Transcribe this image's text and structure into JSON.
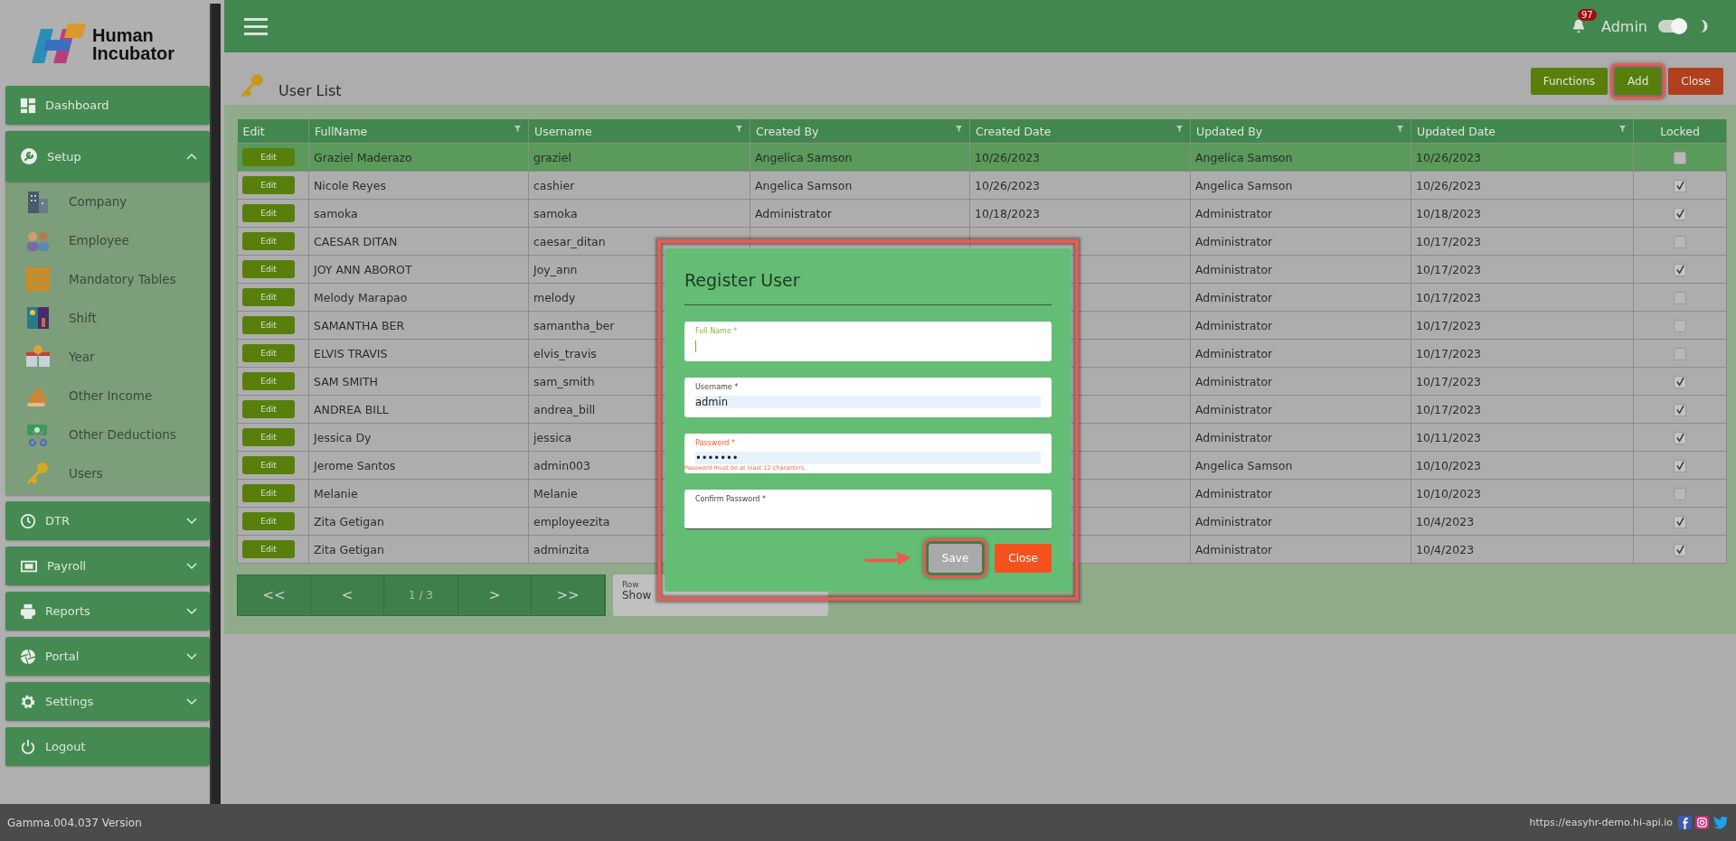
{
  "logo": {
    "line1": "Human",
    "line2": "Incubator"
  },
  "sidebar": {
    "items": [
      {
        "label": "Dashboard",
        "kind": "link"
      },
      {
        "label": "Setup",
        "kind": "group",
        "expanded": true,
        "children": [
          {
            "label": "Company"
          },
          {
            "label": "Employee"
          },
          {
            "label": "Mandatory Tables"
          },
          {
            "label": "Shift"
          },
          {
            "label": "Year"
          },
          {
            "label": "Other Income"
          },
          {
            "label": "Other Deductions"
          },
          {
            "label": "Users"
          }
        ]
      },
      {
        "label": "DTR",
        "kind": "group",
        "expanded": false
      },
      {
        "label": "Payroll",
        "kind": "group",
        "expanded": false
      },
      {
        "label": "Reports",
        "kind": "group",
        "expanded": false
      },
      {
        "label": "Portal",
        "kind": "group",
        "expanded": false
      },
      {
        "label": "Settings",
        "kind": "group",
        "expanded": false
      },
      {
        "label": "Logout",
        "kind": "link"
      }
    ]
  },
  "header": {
    "notifications": "97",
    "user": "Admin",
    "dark_mode": {
      "on": true
    }
  },
  "page": {
    "title": "User List",
    "buttons": [
      {
        "label": "Functions",
        "kind": "primary",
        "highlighted": false
      },
      {
        "label": "Add",
        "kind": "primary",
        "highlighted": true
      },
      {
        "label": "Close",
        "kind": "danger",
        "highlighted": false
      }
    ]
  },
  "table": {
    "columns": [
      {
        "label": "Edit",
        "filter": false
      },
      {
        "label": "FullName",
        "filter": true
      },
      {
        "label": "Username",
        "filter": true
      },
      {
        "label": "Created By",
        "filter": true
      },
      {
        "label": "Created Date",
        "filter": true
      },
      {
        "label": "Updated By",
        "filter": true
      },
      {
        "label": "Updated Date",
        "filter": true
      },
      {
        "label": "Locked",
        "filter": false
      }
    ],
    "rows": [
      {
        "edit": "Edit",
        "full_name": "Graziel Maderazo",
        "username": "graziel",
        "created_by": "Angelica Samson",
        "created_date": "10/26/2023",
        "updated_by": "Angelica Samson",
        "updated_date": "10/26/2023",
        "locked": false,
        "selected": true
      },
      {
        "edit": "Edit",
        "full_name": "Nicole Reyes",
        "username": "cashier",
        "created_by": "Angelica Samson",
        "created_date": "10/26/2023",
        "updated_by": "Angelica Samson",
        "updated_date": "10/26/2023",
        "locked": true,
        "selected": false
      },
      {
        "edit": "Edit",
        "full_name": "samoka",
        "username": "samoka",
        "created_by": "Administrator",
        "created_date": "10/18/2023",
        "updated_by": "Administrator",
        "updated_date": "10/18/2023",
        "locked": true,
        "selected": false
      },
      {
        "edit": "Edit",
        "full_name": "CAESAR DITAN",
        "username": "caesar_ditan",
        "updated_by": "Administrator",
        "updated_date": "10/17/2023",
        "locked": false,
        "selected": false
      },
      {
        "edit": "Edit",
        "full_name": "JOY ANN ABOROT",
        "username": "Joy_ann",
        "updated_by": "Administrator",
        "updated_date": "10/17/2023",
        "locked": true,
        "selected": false
      },
      {
        "edit": "Edit",
        "full_name": "Melody Marapao",
        "username": "melody",
        "updated_by": "Administrator",
        "updated_date": "10/17/2023",
        "locked": false,
        "selected": false
      },
      {
        "edit": "Edit",
        "full_name": "SAMANTHA BER",
        "username": "samantha_ber",
        "updated_by": "Administrator",
        "updated_date": "10/17/2023",
        "locked": false,
        "selected": false
      },
      {
        "edit": "Edit",
        "full_name": "ELVIS TRAVIS",
        "username": "elvis_travis",
        "updated_by": "Administrator",
        "updated_date": "10/17/2023",
        "locked": false,
        "selected": false
      },
      {
        "edit": "Edit",
        "full_name": "SAM SMITH",
        "username": "sam_smith",
        "updated_by": "Administrator",
        "updated_date": "10/17/2023",
        "locked": true,
        "selected": false
      },
      {
        "edit": "Edit",
        "full_name": "ANDREA BILL",
        "username": "andrea_bill",
        "updated_by": "Administrator",
        "updated_date": "10/17/2023",
        "locked": true,
        "selected": false
      },
      {
        "edit": "Edit",
        "full_name": "Jessica Dy",
        "username": "jessica",
        "updated_by": "Administrator",
        "updated_date": "10/11/2023",
        "locked": true,
        "selected": false
      },
      {
        "edit": "Edit",
        "full_name": "Jerome Santos",
        "username": "admin003",
        "updated_by": "Angelica Samson",
        "updated_date": "10/10/2023",
        "locked": true,
        "selected": false
      },
      {
        "edit": "Edit",
        "full_name": "Melanie",
        "username": "Melanie",
        "updated_by": "Administrator",
        "updated_date": "10/10/2023",
        "locked": false,
        "selected": false
      },
      {
        "edit": "Edit",
        "full_name": "Zita Getigan",
        "username": "employeezita",
        "updated_by": "Administrator",
        "updated_date": "10/4/2023",
        "locked": true,
        "selected": false
      },
      {
        "edit": "Edit",
        "full_name": "Zita Getigan",
        "username": "adminzita",
        "updated_by": "Administrator",
        "updated_date": "10/4/2023",
        "locked": true,
        "selected": false
      }
    ]
  },
  "pagination": {
    "first": "<<",
    "prev": "<",
    "page": "1 / 3",
    "next": ">",
    "last": ">>",
    "rows_label": "Row",
    "rows_value": "Show"
  },
  "modal": {
    "title": "Register User",
    "fields": [
      {
        "label": "Full Name *",
        "focused": true,
        "invalid": false
      },
      {
        "label": "Username *",
        "value": "admin",
        "focused": false,
        "invalid": false
      },
      {
        "label": "Password *",
        "value": "•••••••",
        "focused": false,
        "invalid": true,
        "error": "Password must be at least 12 characters."
      },
      {
        "label": "Confirm Password *",
        "focused": false,
        "invalid": false
      }
    ],
    "buttons": [
      {
        "label": "Save",
        "kind": "neutral",
        "highlighted": true
      },
      {
        "label": "Close",
        "kind": "danger",
        "highlighted": false
      }
    ]
  },
  "footer": {
    "version": "Gamma.004.037 Version",
    "url": "https://easyhr-demo.hi-api.io"
  }
}
